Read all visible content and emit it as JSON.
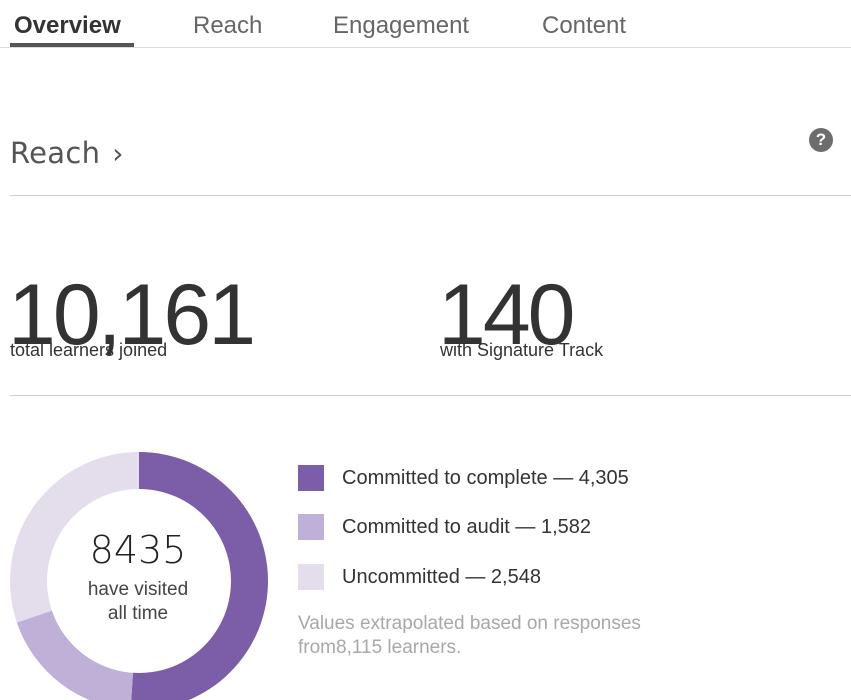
{
  "tabs": [
    {
      "label": "Overview",
      "active": true
    },
    {
      "label": "Reach",
      "active": false
    },
    {
      "label": "Engagement",
      "active": false
    },
    {
      "label": "Content",
      "active": false
    }
  ],
  "section": {
    "title": "Reach",
    "chevron": "›",
    "help_icon": "?"
  },
  "stats": [
    {
      "value": "10,161",
      "label": "total learners joined"
    },
    {
      "value": "140",
      "label": "with Signature Track"
    }
  ],
  "donut": {
    "center_value": "8435",
    "center_line1": "have visited",
    "center_line2": "all time"
  },
  "legend": [
    {
      "label": "Committed to complete — 4,305",
      "color": "#7b5ea7"
    },
    {
      "label": "Committed to audit — 1,582",
      "color": "#bfb0d8"
    },
    {
      "label": "Uncommitted — 2,548",
      "color": "#e3ddec"
    }
  ],
  "note_line1": "Values extrapolated based on responses",
  "note_line2": "from8,115 learners.",
  "chart_data": {
    "type": "pie",
    "categories": [
      "Committed to complete",
      "Committed to audit",
      "Uncommitted"
    ],
    "values": [
      4305,
      1582,
      2548
    ],
    "colors": [
      "#7b5ea7",
      "#bfb0d8",
      "#e3ddec"
    ],
    "center_text": "8435"
  }
}
